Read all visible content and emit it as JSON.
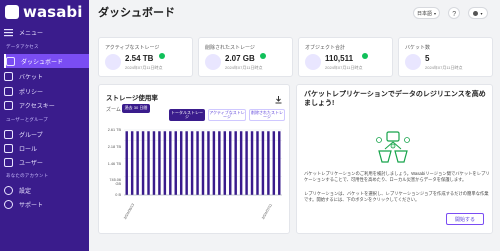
{
  "app": {
    "brand": "wasabi",
    "accent": "#3a1c8c"
  },
  "sidebar": {
    "menu_label": "メニュー",
    "sections": [
      {
        "title": "データアクセス",
        "items": [
          {
            "label": "ダッシュボード",
            "icon": "dashboard-icon",
            "active": true
          },
          {
            "label": "バケット",
            "icon": "bucket-icon"
          },
          {
            "label": "ポリシー",
            "icon": "policy-icon"
          },
          {
            "label": "アクセスキー",
            "icon": "key-icon"
          }
        ]
      },
      {
        "title": "ユーザーとグループ",
        "items": [
          {
            "label": "グループ",
            "icon": "group-icon"
          },
          {
            "label": "ロール",
            "icon": "role-icon"
          },
          {
            "label": "ユーザー",
            "icon": "user-icon"
          }
        ]
      },
      {
        "title": "あなたのアカウント",
        "items": [
          {
            "label": "設定",
            "icon": "settings-icon"
          },
          {
            "label": "サポート",
            "icon": "support-icon"
          }
        ]
      }
    ]
  },
  "header": {
    "title": "ダッシュボード",
    "language": "日本語",
    "help_icon": "help-icon",
    "account_icon": "account-icon"
  },
  "stats": [
    {
      "label": "アクティブなストレージ",
      "value": "2.54 TB",
      "subtitle": "2024年07月11日時点",
      "icon": "cloud-icon"
    },
    {
      "label": "削除されたストレージ",
      "value": "2.07 GB",
      "subtitle": "2024年07月11日時点",
      "icon": "deleted-cloud-icon"
    },
    {
      "label": "オブジェクト合計",
      "value": "110,511",
      "subtitle": "2024年07月11日時点",
      "icon": "object-icon"
    },
    {
      "label": "バケット数",
      "value": "5",
      "subtitle": "2024年07月11日時点",
      "icon": "bucket-icon"
    }
  ],
  "storage_panel": {
    "title": "ストレージ使用率",
    "zoom_label": "ズーム",
    "zoom_value": "過去 30 日間",
    "toggles": [
      "トータルストレージ",
      "アクティブなストレージ",
      "削除されたストレージ"
    ],
    "download_icon": "download-icon"
  },
  "chart_data": {
    "type": "bar",
    "categories": [
      "2024/06/13",
      "2024/07/11"
    ],
    "series_count": 29,
    "y_ticks": [
      "2.61 TB",
      "2.18 TB",
      "1.46 TB",
      "745.06 GB",
      "0 B"
    ],
    "x_ticks": [
      "2024/06/13",
      "2024/07/11"
    ],
    "values_tb": [
      2.56,
      2.56,
      2.56,
      2.56,
      2.56,
      2.56,
      2.56,
      2.56,
      2.56,
      2.56,
      2.56,
      2.56,
      2.56,
      2.56,
      2.56,
      2.56,
      2.56,
      2.56,
      2.56,
      2.56,
      2.56,
      2.56,
      2.56,
      2.56,
      2.56,
      2.56,
      2.56,
      2.56,
      2.56
    ],
    "ylim": [
      0,
      2.61
    ],
    "bar_color": "#3a1c8c"
  },
  "replication_panel": {
    "title": "バケットレプリケーションでデータのレジリエンスを高めましょう!",
    "paragraph1": "バケットレプリケーションのご利用を検討しましょう。Wasabiリージョン間でバケットをレプリケーションすることで、可用性を高めたり、ローカル災害からデータを保護します。",
    "paragraph2": "レプリケーションは、バケットを選択し、レプリケーションジョブを作成するだけの簡単な作業です。開始するには、下のボタンをクリックしてください。",
    "button": "開始する",
    "illustration_icon": "replication-illustration-icon"
  }
}
